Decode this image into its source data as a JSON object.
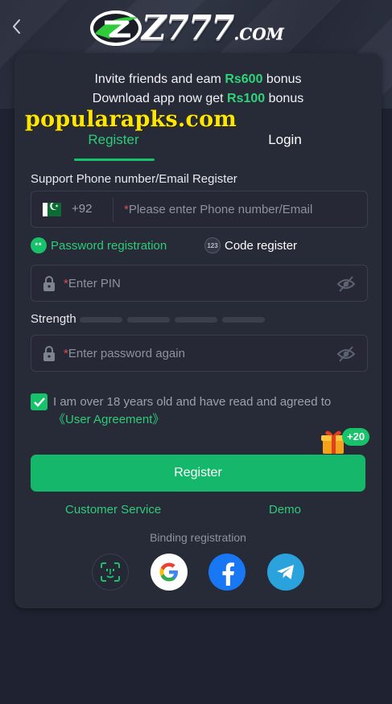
{
  "header": {
    "logo_text": "Z777",
    "logo_domain": ".COM"
  },
  "promo": {
    "line1_prefix": "Invite friends and eam ",
    "line1_amount": "Rs600",
    "line1_suffix": " bonus",
    "line2_prefix": "Download app now get ",
    "line2_amount": "Rs100",
    "line2_suffix": " bonus"
  },
  "watermark": "popularapks.com",
  "tabs": {
    "register": "Register",
    "login": "Login"
  },
  "form": {
    "support_label": "Support Phone number/Email Register",
    "country_code": "+92",
    "required_mark": "*",
    "phone_placeholder": "Please enter Phone number/Email",
    "option_password": "Password registration",
    "option_code": "Code register",
    "option_code_icon": "123",
    "option_password_icon": "**",
    "pin_placeholder": "Enter PIN",
    "strength_label": "Strength",
    "password_again_placeholder": "Enter password again",
    "agree_text": "I am over 18 years old and have read and agreed to ",
    "agree_link": "《User Agreement》",
    "gift_badge": "+20",
    "register_button": "Register"
  },
  "footer": {
    "customer_service": "Customer Service",
    "demo": "Demo",
    "binding_label": "Binding registration"
  },
  "colors": {
    "accent": "#17c26a",
    "background": "#1f2230",
    "card": "#272a37",
    "required": "#e04b4b",
    "watermark": "#ffe600"
  },
  "icons": [
    "back-chevron-icon",
    "pakistan-flag-icon",
    "lock-icon",
    "eye-off-icon",
    "checkmark-icon",
    "gift-icon",
    "face-id-icon",
    "google-icon",
    "facebook-icon",
    "telegram-icon"
  ]
}
